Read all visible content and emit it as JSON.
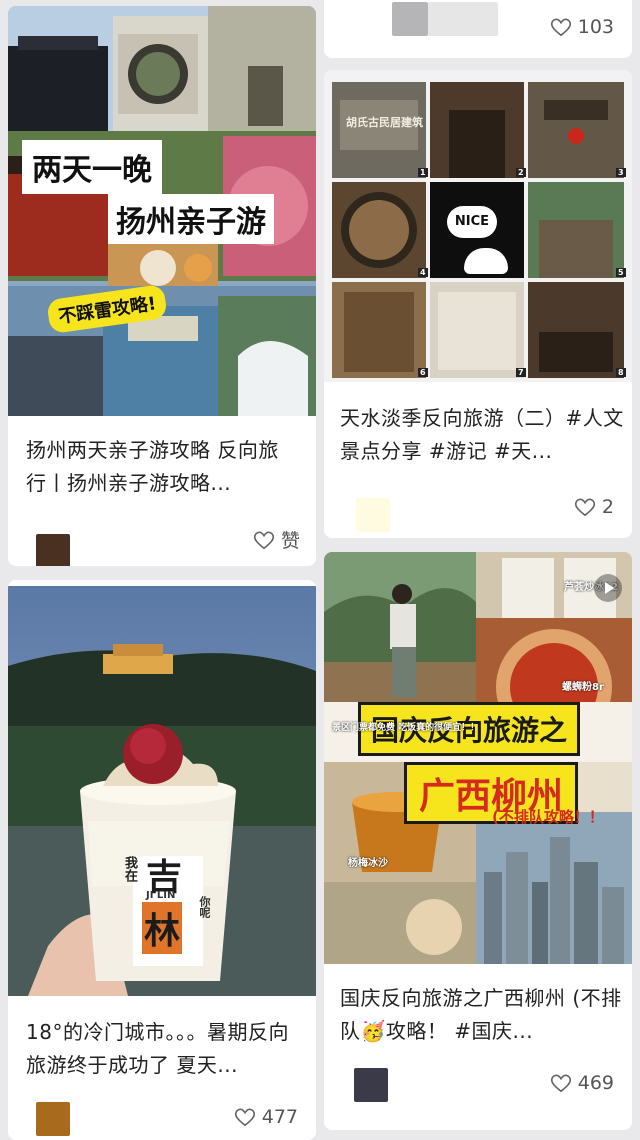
{
  "cards": [
    {
      "title": "扬州两天亲子游攻略 反向旅行丨扬州亲子游攻略...",
      "like_label": "赞",
      "cover_text": [
        "两天一晚",
        "扬州亲子游",
        "不踩雷攻略!"
      ]
    },
    {
      "title": "18°的冷门城市。。。暑期反向旅游终于成功了 夏天...",
      "like_count": "477",
      "cover_text": [
        "我在",
        "吉",
        "林",
        "JI LIN",
        "你呢"
      ]
    },
    {
      "like_count": "103"
    },
    {
      "title": "天水淡季反向旅游（二）#人文景点分享 #游记 #天...",
      "like_count": "2",
      "grid_labels": [
        "胡氏古民居建筑",
        "NICE",
        "1",
        "2",
        "3",
        "4",
        "5",
        "6",
        "7",
        "8"
      ]
    },
    {
      "title": "国庆反向旅游之广西柳州 (不排队🥳攻略！ #国庆...",
      "like_count": "469",
      "cover_text": [
        "国庆反向旅游之",
        "广西柳州",
        "(不排队攻略！！",
        "景区门票都免费 吃饭真的很便宜！！",
        "螺蛳粉8r",
        "杨梅冰沙",
        "芦荟炒冰12"
      ]
    }
  ],
  "colors": {
    "background": "#e9e9ec",
    "card": "#ffffff",
    "text": "#222222",
    "meta": "#555555",
    "accent_yellow": "#f6e51c",
    "accent_red": "#d52a1e"
  }
}
